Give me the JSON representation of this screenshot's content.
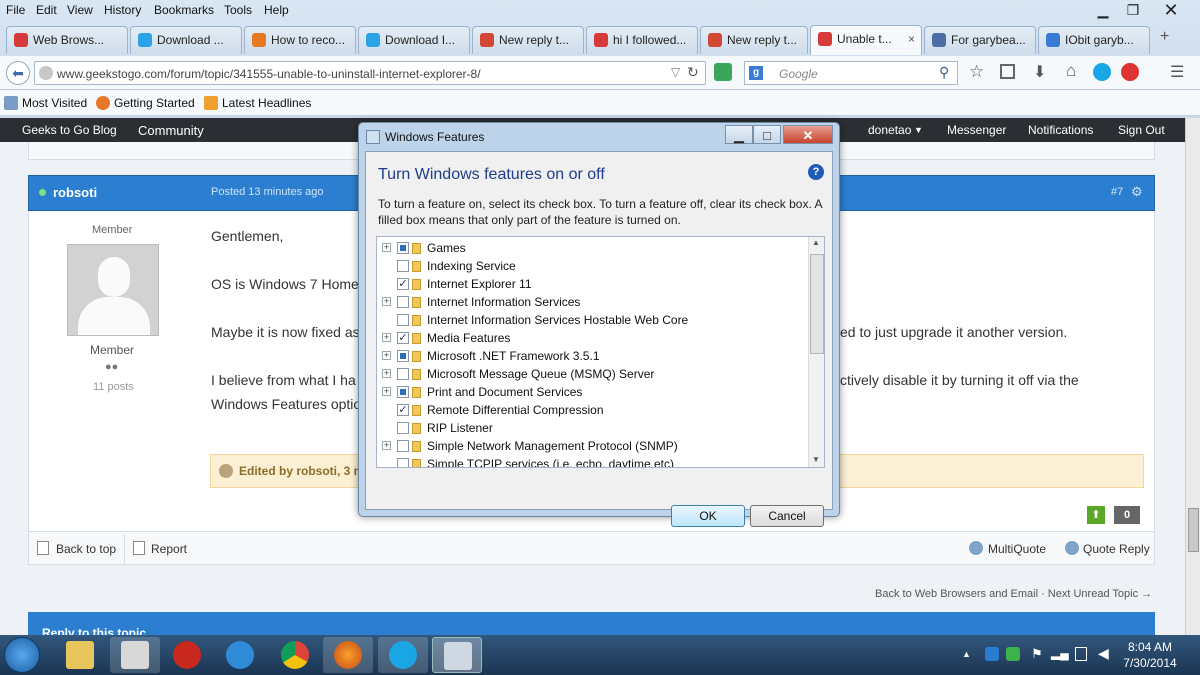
{
  "menubar": {
    "items": [
      "File",
      "Edit",
      "View",
      "History",
      "Bookmarks",
      "Tools",
      "Help"
    ]
  },
  "tabs": [
    {
      "label": "Web Brows...",
      "icon": "geekstogo-icon",
      "color": "#d63a3a"
    },
    {
      "label": "Download ...",
      "icon": "windows-icon",
      "color": "#2aa4e6"
    },
    {
      "label": "How to reco...",
      "icon": "windows-flag-icon",
      "color": "#e67a22"
    },
    {
      "label": "Download I...",
      "icon": "windows-icon",
      "color": "#2aa4e6"
    },
    {
      "label": "New reply t...",
      "icon": "gmail-icon",
      "color": "#d14836"
    },
    {
      "label": "hi I followed...",
      "icon": "geekstogo-icon",
      "color": "#d63a3a"
    },
    {
      "label": "New reply t...",
      "icon": "gmail-icon",
      "color": "#d14836"
    },
    {
      "label": "Unable t...",
      "icon": "geekstogo-icon",
      "color": "#d63a3a",
      "close": "×"
    },
    {
      "label": "For garybea...",
      "icon": "forum-icon",
      "color": "#4a6fa5"
    },
    {
      "label": "IObit garyb...",
      "icon": "google-icon",
      "color": "#3a7bd5"
    }
  ],
  "navbar": {
    "url": "www.geekstogo.com/forum/topic/341555-unable-to-uninstall-internet-explorer-8/",
    "search_placeholder": "Google"
  },
  "bookmarks": [
    "Most Visited",
    "Getting Started",
    "Latest Headlines"
  ],
  "site_nav": {
    "blog": "Geeks to Go Blog",
    "community": "Community",
    "user": "donetao",
    "messenger": "Messenger",
    "notifications": "Notifications",
    "signout": "Sign Out"
  },
  "post": {
    "author": "robsoti",
    "posted": "Posted 13 minutes ago",
    "number": "#7",
    "role_top": "Member",
    "role": "Member",
    "rating_dots": "●●",
    "posts": "11 posts",
    "line1": "Gentlemen,",
    "line2": "OS is Windows 7 Home",
    "line3a": "Maybe it is now fixed as",
    "line3b": "ed to just upgrade it another version.",
    "line4a": "I believe from what I ha",
    "line4b": "ctively disable it by turning it off via the",
    "line5": "Windows Features optio",
    "edited": "Edited by robsoti, 3 mi",
    "vote_count": "0"
  },
  "actions": {
    "back_to_top": "Back to top",
    "report": "Report",
    "multiquote": "MultiQuote",
    "quote_reply": "Quote Reply"
  },
  "footer_nav": "Back to Web Browsers and Email · Next Unread Topic →",
  "reply_bar": "Reply to this topic",
  "dialog": {
    "title": "Windows Features",
    "heading": "Turn Windows features on or off",
    "description": "To turn a feature on, select its check box. To turn a feature off, clear its check box. A filled box means that only part of the feature is turned on.",
    "features": [
      {
        "label": "Games",
        "expandable": true,
        "state": "partial"
      },
      {
        "label": "Indexing Service",
        "expandable": false,
        "state": "off"
      },
      {
        "label": "Internet Explorer 11",
        "expandable": false,
        "state": "on"
      },
      {
        "label": "Internet Information Services",
        "expandable": true,
        "state": "off"
      },
      {
        "label": "Internet Information Services Hostable Web Core",
        "expandable": false,
        "state": "off"
      },
      {
        "label": "Media Features",
        "expandable": true,
        "state": "on"
      },
      {
        "label": "Microsoft .NET Framework 3.5.1",
        "expandable": true,
        "state": "partial"
      },
      {
        "label": "Microsoft Message Queue (MSMQ) Server",
        "expandable": true,
        "state": "off"
      },
      {
        "label": "Print and Document Services",
        "expandable": true,
        "state": "partial"
      },
      {
        "label": "Remote Differential Compression",
        "expandable": false,
        "state": "on"
      },
      {
        "label": "RIP Listener",
        "expandable": false,
        "state": "off"
      },
      {
        "label": "Simple Network Management Protocol (SNMP)",
        "expandable": true,
        "state": "off"
      },
      {
        "label": "Simple TCPIP services (i.e. echo, daytime etc)",
        "expandable": false,
        "state": "off"
      }
    ],
    "ok": "OK",
    "cancel": "Cancel"
  },
  "taskbar": {
    "time": "8:04 AM",
    "date": "7/30/2014"
  }
}
